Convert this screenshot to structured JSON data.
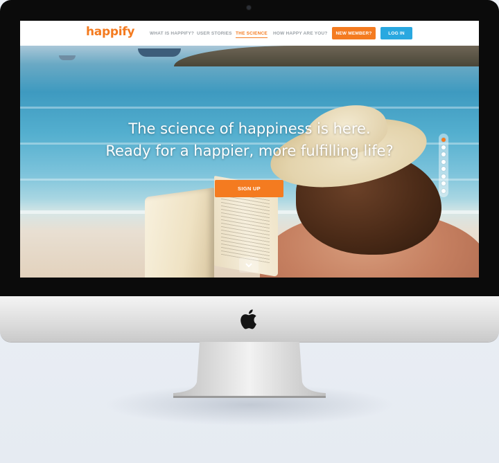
{
  "site": {
    "logo": "happify",
    "brand_color": "#f47b20",
    "login_color": "#29a8e0"
  },
  "nav": {
    "links": [
      {
        "label": "WHAT IS HAPPIFY?",
        "active": false
      },
      {
        "label": "USER STORIES",
        "active": false
      },
      {
        "label": "THE SCIENCE",
        "active": true
      },
      {
        "label": "HOW HAPPY ARE YOU?",
        "active": false
      }
    ],
    "new_member_label": "NEW MEMBER?",
    "login_label": "LOG IN"
  },
  "hero": {
    "headline_line1": "The science of happiness is here.",
    "headline_line2": "Ready for a happier, more fulfilling life?",
    "signup_label": "SIGN UP",
    "scroll_icon": "chevron-down-icon",
    "slides_total": 8,
    "slide_active": 1
  },
  "device": {
    "logo_icon": "apple-icon"
  }
}
